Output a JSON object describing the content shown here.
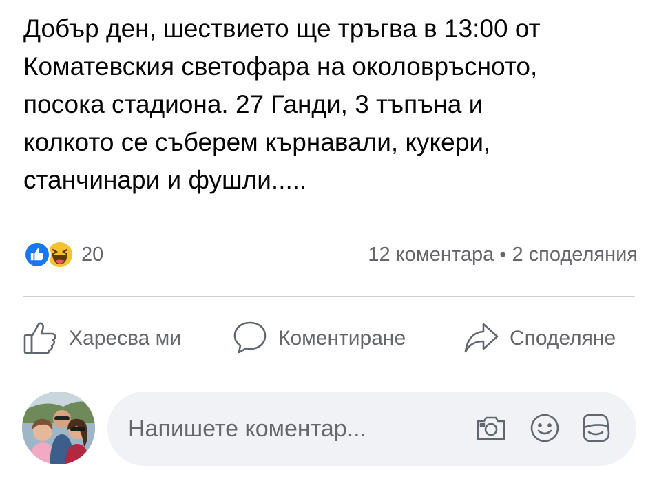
{
  "post": {
    "text": "Добър ден, шествието ще тръгва в 13:00 от\nКоматевския светофара на околовръсното,\nпосока стадиона. 27 Ганди, 3 тъпъна и\nколкото се съберем кърнавали, кукери,\nстанчинари и фушли....."
  },
  "stats": {
    "reaction_icons": [
      "like-icon",
      "haha-icon"
    ],
    "reactions_count": "20",
    "comments_shares": "12 коментара • 2 споделяния"
  },
  "actions": {
    "like_label": "Харесва ми",
    "comment_label": "Коментиране",
    "share_label": "Споделяне"
  },
  "composer": {
    "placeholder": "Напишете коментар...",
    "icons": [
      "camera-icon",
      "emoji-icon",
      "gif-sticker-icon"
    ]
  },
  "colors": {
    "like_blue": "#1877f2",
    "haha_yellow": "#f7c22f",
    "secondary_text": "#65676b",
    "input_bg": "#f0f2f5"
  }
}
